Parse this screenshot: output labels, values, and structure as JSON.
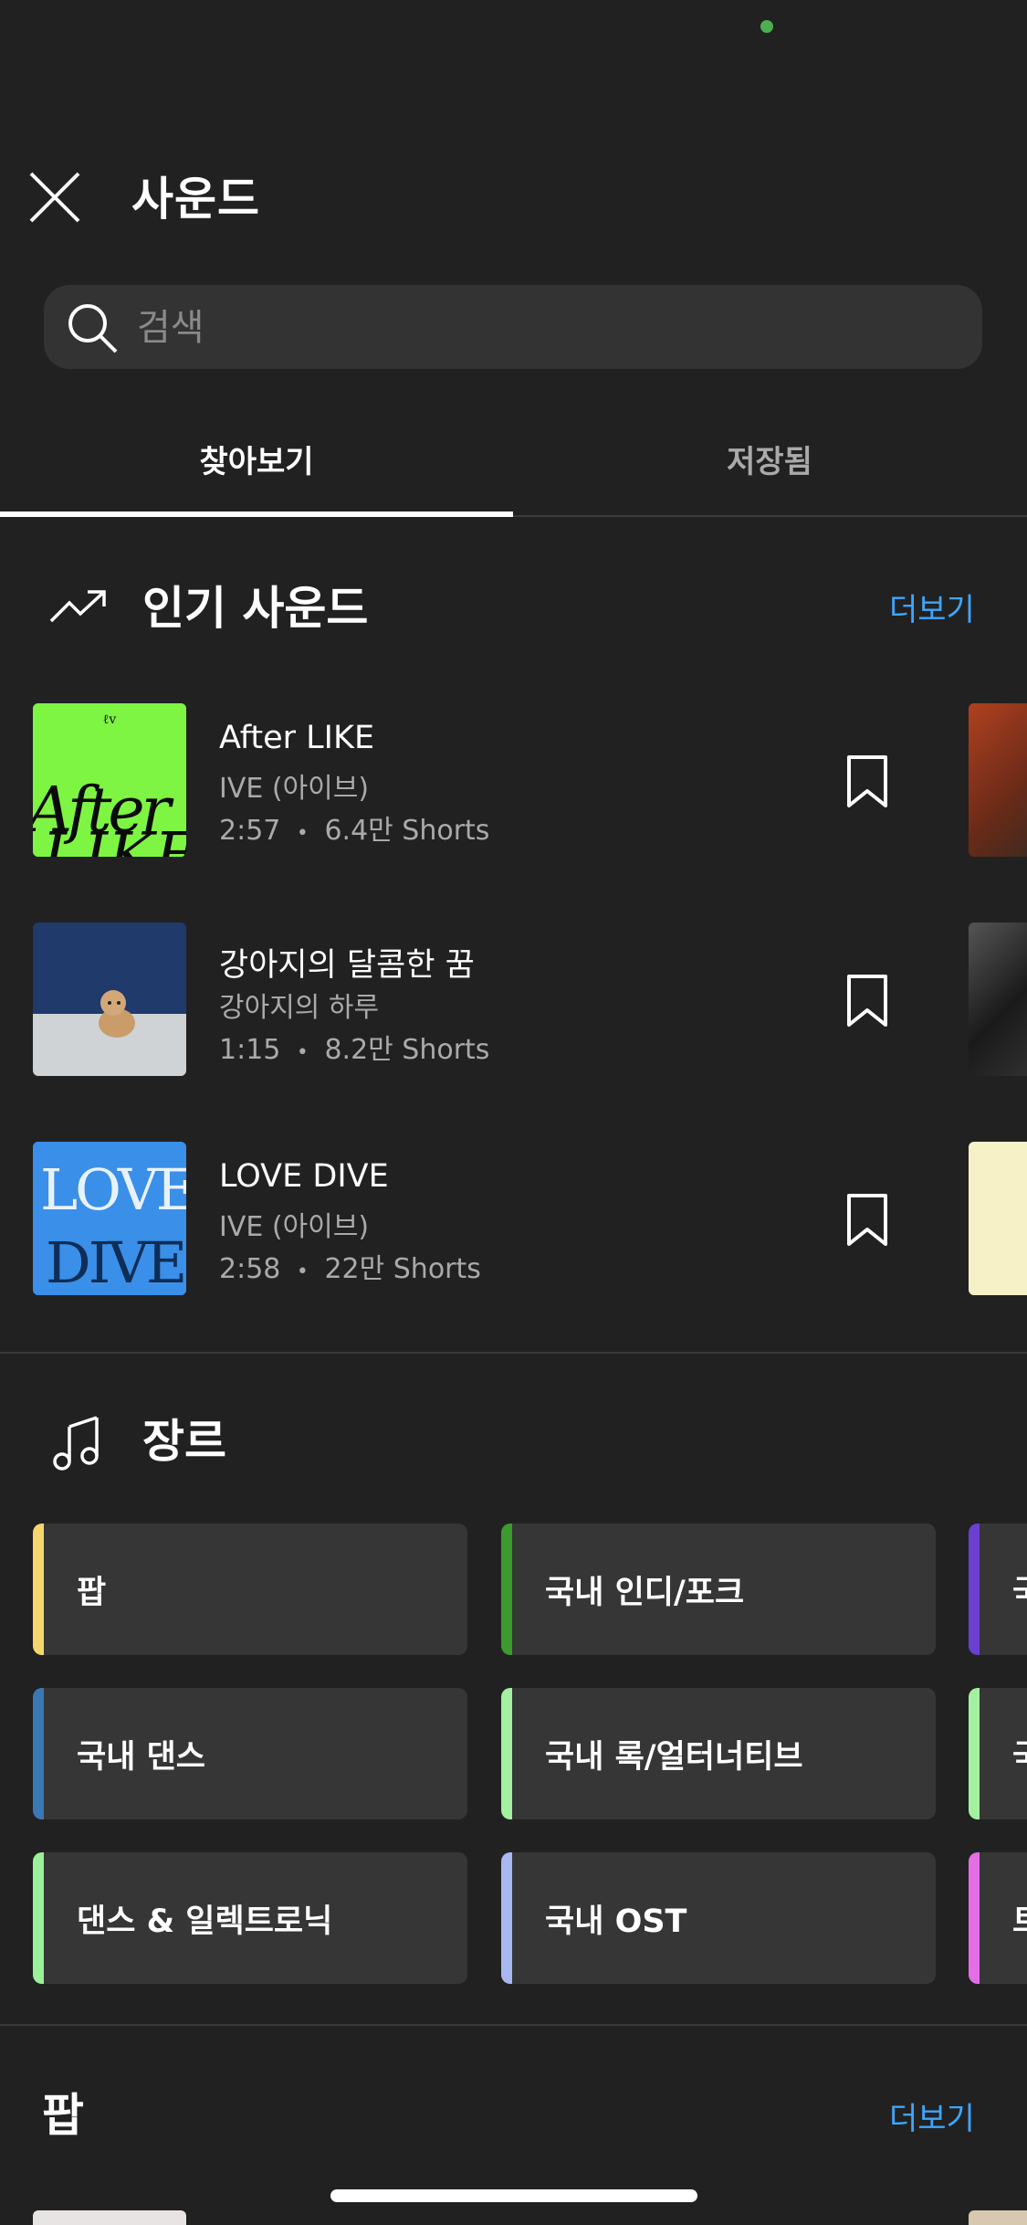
{
  "header": {
    "title": "사운드",
    "close_icon": "close-icon"
  },
  "search": {
    "placeholder": "검색",
    "value": ""
  },
  "tabs": [
    {
      "label": "찾아보기",
      "active": true
    },
    {
      "label": "저장됨",
      "active": false
    }
  ],
  "trending": {
    "title": "인기 사운드",
    "more": "더보기",
    "songs": [
      {
        "title": "After LIKE",
        "artist": "IVE (아이브)",
        "duration": "2:57",
        "uses": "6.4만 Shorts"
      },
      {
        "title": "강아지의 달콤한 꿈",
        "artist": "강아지의 하루",
        "duration": "1:15",
        "uses": "8.2만 Shorts"
      },
      {
        "title": "LOVE DIVE",
        "artist": "IVE (아이브)",
        "duration": "2:58",
        "uses": "22만 Shorts"
      }
    ]
  },
  "genres": {
    "title": "장르",
    "items": [
      {
        "label": "팝",
        "color": "#f5d76e"
      },
      {
        "label": "국내 인디/포크",
        "color": "#3c9a2e"
      },
      {
        "label": "국",
        "color": "#6a3fd1"
      },
      {
        "label": "국내 댄스",
        "color": "#3a78b5"
      },
      {
        "label": "국내 록/얼터너티브",
        "color": "#a3f0a0"
      },
      {
        "label": "국",
        "color": "#a3f0a0"
      },
      {
        "label": "댄스 & 일렉트로닉",
        "color": "#9bf09a"
      },
      {
        "label": "국내 OST",
        "color": "#a9b7f0"
      },
      {
        "label": "트",
        "color": "#e36ee6"
      }
    ]
  },
  "pop": {
    "title": "팝",
    "more": "더보기"
  },
  "colors": {
    "background": "#212121",
    "accent": "#3ea6ff",
    "secondary_text": "#aaaaaa"
  }
}
